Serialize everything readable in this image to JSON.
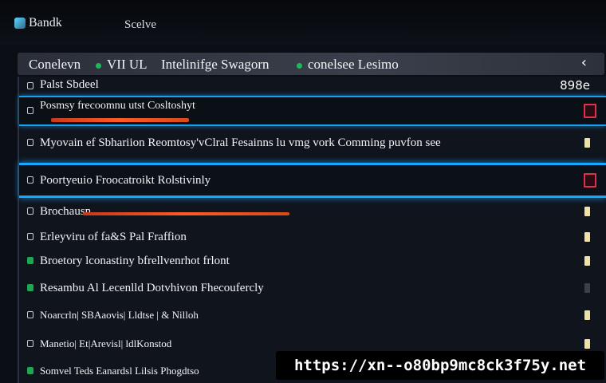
{
  "topbar": {
    "brand": "Bandk",
    "tab": "Scelve"
  },
  "toolbar": {
    "crumbs": [
      "Conelevn",
      "VII UL",
      "Intelinifge Swagorn",
      "conelsee Lesimo"
    ],
    "back_icon": "chevron-left-icon"
  },
  "list": {
    "header_label": "Palst Sbdeel",
    "header_right": "898e",
    "rows": [
      {
        "label": "Posmsy frecoomnu utst Cosltoshyt",
        "marker": "red"
      },
      {
        "label": "Myovain ef Sbhariion Reomtosy'vClral Fesainns lu vmg vork Comming puvfon see",
        "marker": "yellow"
      },
      {
        "label": "Poortyeuio Froocatroikt Rolstivinly",
        "marker": "red"
      },
      {
        "label": "Brochausn",
        "marker": "yellow"
      },
      {
        "label": "Erleyviru of fa&S Pal Fraffion",
        "marker": "yellow"
      },
      {
        "label": "Broetory lconastiny bfrellvenrhot frlont",
        "marker": "yellow"
      },
      {
        "label": "Resambu Al Lecenlld Dotvhivon Fhecoufercly",
        "marker": "dim"
      },
      {
        "label": "Noarcrln| SBAaovis| Lldtse | & Nilloh",
        "marker": "yellow"
      },
      {
        "label": "Manetio| Et|Arevisl| ldlKonstod",
        "marker": "yellow"
      },
      {
        "label": "Somvel Teds Eanardsl Lilsis Phogdtso",
        "marker": "none"
      }
    ]
  },
  "overlay": {
    "url": "https://xn--o80bp9mc8ck3f75y.net"
  },
  "colors": {
    "accent_blue": "#1d9ff0",
    "progress_orange": "#ff5a22",
    "status_red": "#e0304f",
    "status_green": "#1ea653",
    "marker_yellow": "#efe1a6"
  },
  "progress": {
    "row1_fraction": 0.29,
    "row4_fraction": 0.46
  }
}
